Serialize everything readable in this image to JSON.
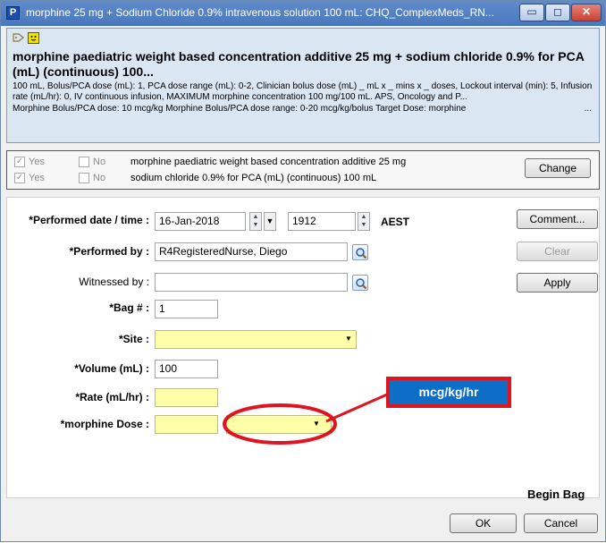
{
  "window": {
    "title": "morphine 25 mg + Sodium Chloride 0.9% intravenous solution 100 mL: CHQ_ComplexMeds_RN...",
    "app_icon_letter": "P",
    "controls": {
      "minimize": "▭",
      "maximize": "◻",
      "close": "✕"
    }
  },
  "header": {
    "med_title": "morphine paediatric weight based concentration additive 25 mg + sodium chloride 0.9% for PCA (mL) (continuous) 100...",
    "details": "100 mL, Bolus/PCA dose (mL): 1, PCA dose range (mL): 0-2, Clinician bolus dose (mL) _ mL x _ mins x _ doses, Lockout interval (min): 5, Infusion rate (mL/hr): 0, IV continuous infusion, MAXIMUM morphine concentration 100 mg/100 mL. APS, Oncology and P...",
    "dose_line": "Morphine Bolus/PCA dose: 10 mcg/kg   Morphine Bolus/PCA dose range: 0-20 mcg/kg/bolus  Target Dose: morphine",
    "ellipsis": "..."
  },
  "orders": {
    "yes_label": "Yes",
    "no_label": "No",
    "check_mark": "✓",
    "rows": [
      {
        "text": "morphine paediatric weight based concentration additive 25 mg"
      },
      {
        "text": "sodium chloride 0.9% for PCA (mL) (continuous) 100 mL"
      }
    ],
    "change_label": "Change"
  },
  "form": {
    "performed_date_label": "*Performed date / time :",
    "performed_date_value": "16-Jan-2018",
    "performed_time_value": "1912",
    "timezone": "AEST",
    "performed_by_label": "*Performed by :",
    "performed_by_value": "R4RegisteredNurse, Diego",
    "witnessed_by_label": "Witnessed by :",
    "witnessed_by_value": "",
    "bag_label": "*Bag # :",
    "bag_value": "1",
    "site_label": "*Site :",
    "site_value": "",
    "volume_label": "*Volume (mL) :",
    "volume_value": "100",
    "rate_label": "*Rate (mL/hr) :",
    "rate_value": "",
    "dose_label": "*morphine Dose :",
    "dose_value": "",
    "dose_unit_value": "",
    "begin_bag": "Begin Bag"
  },
  "buttons": {
    "comment": "Comment...",
    "clear": "Clear",
    "apply": "Apply",
    "ok": "OK",
    "cancel": "Cancel"
  },
  "annotation": {
    "callout_text": "mcg/kg/hr",
    "callout_color": "#0c6ec6",
    "highlight_color": "#e0141f"
  }
}
